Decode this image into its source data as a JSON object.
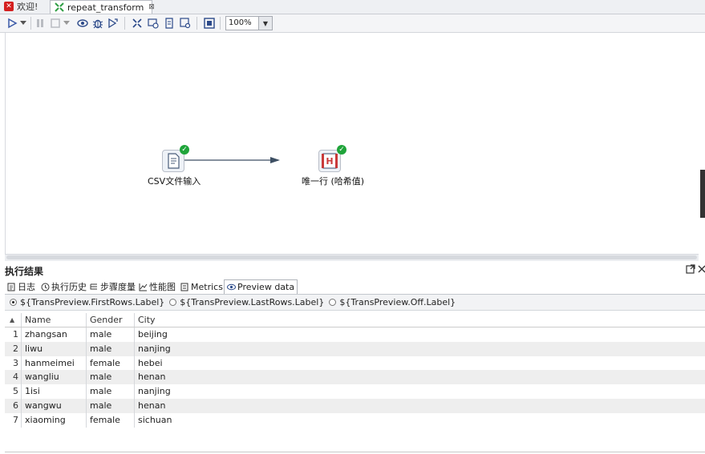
{
  "tabs": [
    {
      "label": "欢迎!"
    },
    {
      "label": "repeat_transform"
    }
  ],
  "toolbar": {
    "zoom": "100%"
  },
  "canvas": {
    "steps": [
      {
        "label": "CSV文件输入"
      },
      {
        "label": "唯一行 (哈希值)"
      }
    ]
  },
  "results": {
    "title": "执行结果",
    "tabs": [
      {
        "label": "日志"
      },
      {
        "label": "执行历史"
      },
      {
        "label": "步骤度量"
      },
      {
        "label": "性能图"
      },
      {
        "label": "Metrics"
      },
      {
        "label": "Preview data"
      }
    ],
    "radios": [
      {
        "label": "${TransPreview.FirstRows.Label}",
        "selected": true
      },
      {
        "label": "${TransPreview.LastRows.Label}",
        "selected": false
      },
      {
        "label": "${TransPreview.Off.Label}",
        "selected": false
      }
    ],
    "table": {
      "columns": [
        "Name",
        "Gender",
        "City"
      ],
      "rows": [
        {
          "n": "1",
          "name": "zhangsan",
          "gender": "male",
          "city": "beijing"
        },
        {
          "n": "2",
          "name": "liwu",
          "gender": "male",
          "city": "nanjing"
        },
        {
          "n": "3",
          "name": "hanmeimei",
          "gender": "female",
          "city": "hebei"
        },
        {
          "n": "4",
          "name": "wangliu",
          "gender": "male",
          "city": "henan"
        },
        {
          "n": "5",
          "name": "1isi",
          "gender": "male",
          "city": "nanjing"
        },
        {
          "n": "6",
          "name": "wangwu",
          "gender": "male",
          "city": "henan"
        },
        {
          "n": "7",
          "name": "xiaoming",
          "gender": "female",
          "city": "sichuan"
        }
      ]
    }
  },
  "colors": {
    "success": "#1fa43a",
    "hop": "#3d4f63"
  }
}
